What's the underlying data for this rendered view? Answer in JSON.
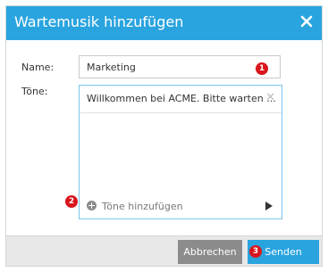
{
  "dialog": {
    "title": "Wartemusik hinzufügen",
    "close_icon": "close-icon"
  },
  "form": {
    "name_label": "Name:",
    "name_value": "Marketing",
    "tones_label": "Töne:",
    "tones": [
      {
        "text": "Willkommen bei ACME. Bitte warten ...",
        "remove_icon": "close-icon"
      }
    ],
    "add_tones_label": "Töne hinzufügen",
    "add_icon": "plus-circle-icon",
    "play_icon": "play-icon"
  },
  "footer": {
    "cancel_label": "Abbrechen",
    "send_label": "Senden"
  },
  "badges": [
    "1",
    "2",
    "3"
  ],
  "colors": {
    "accent": "#2aa4df",
    "badge": "#d9151b",
    "cancel": "#8c8c8c"
  }
}
